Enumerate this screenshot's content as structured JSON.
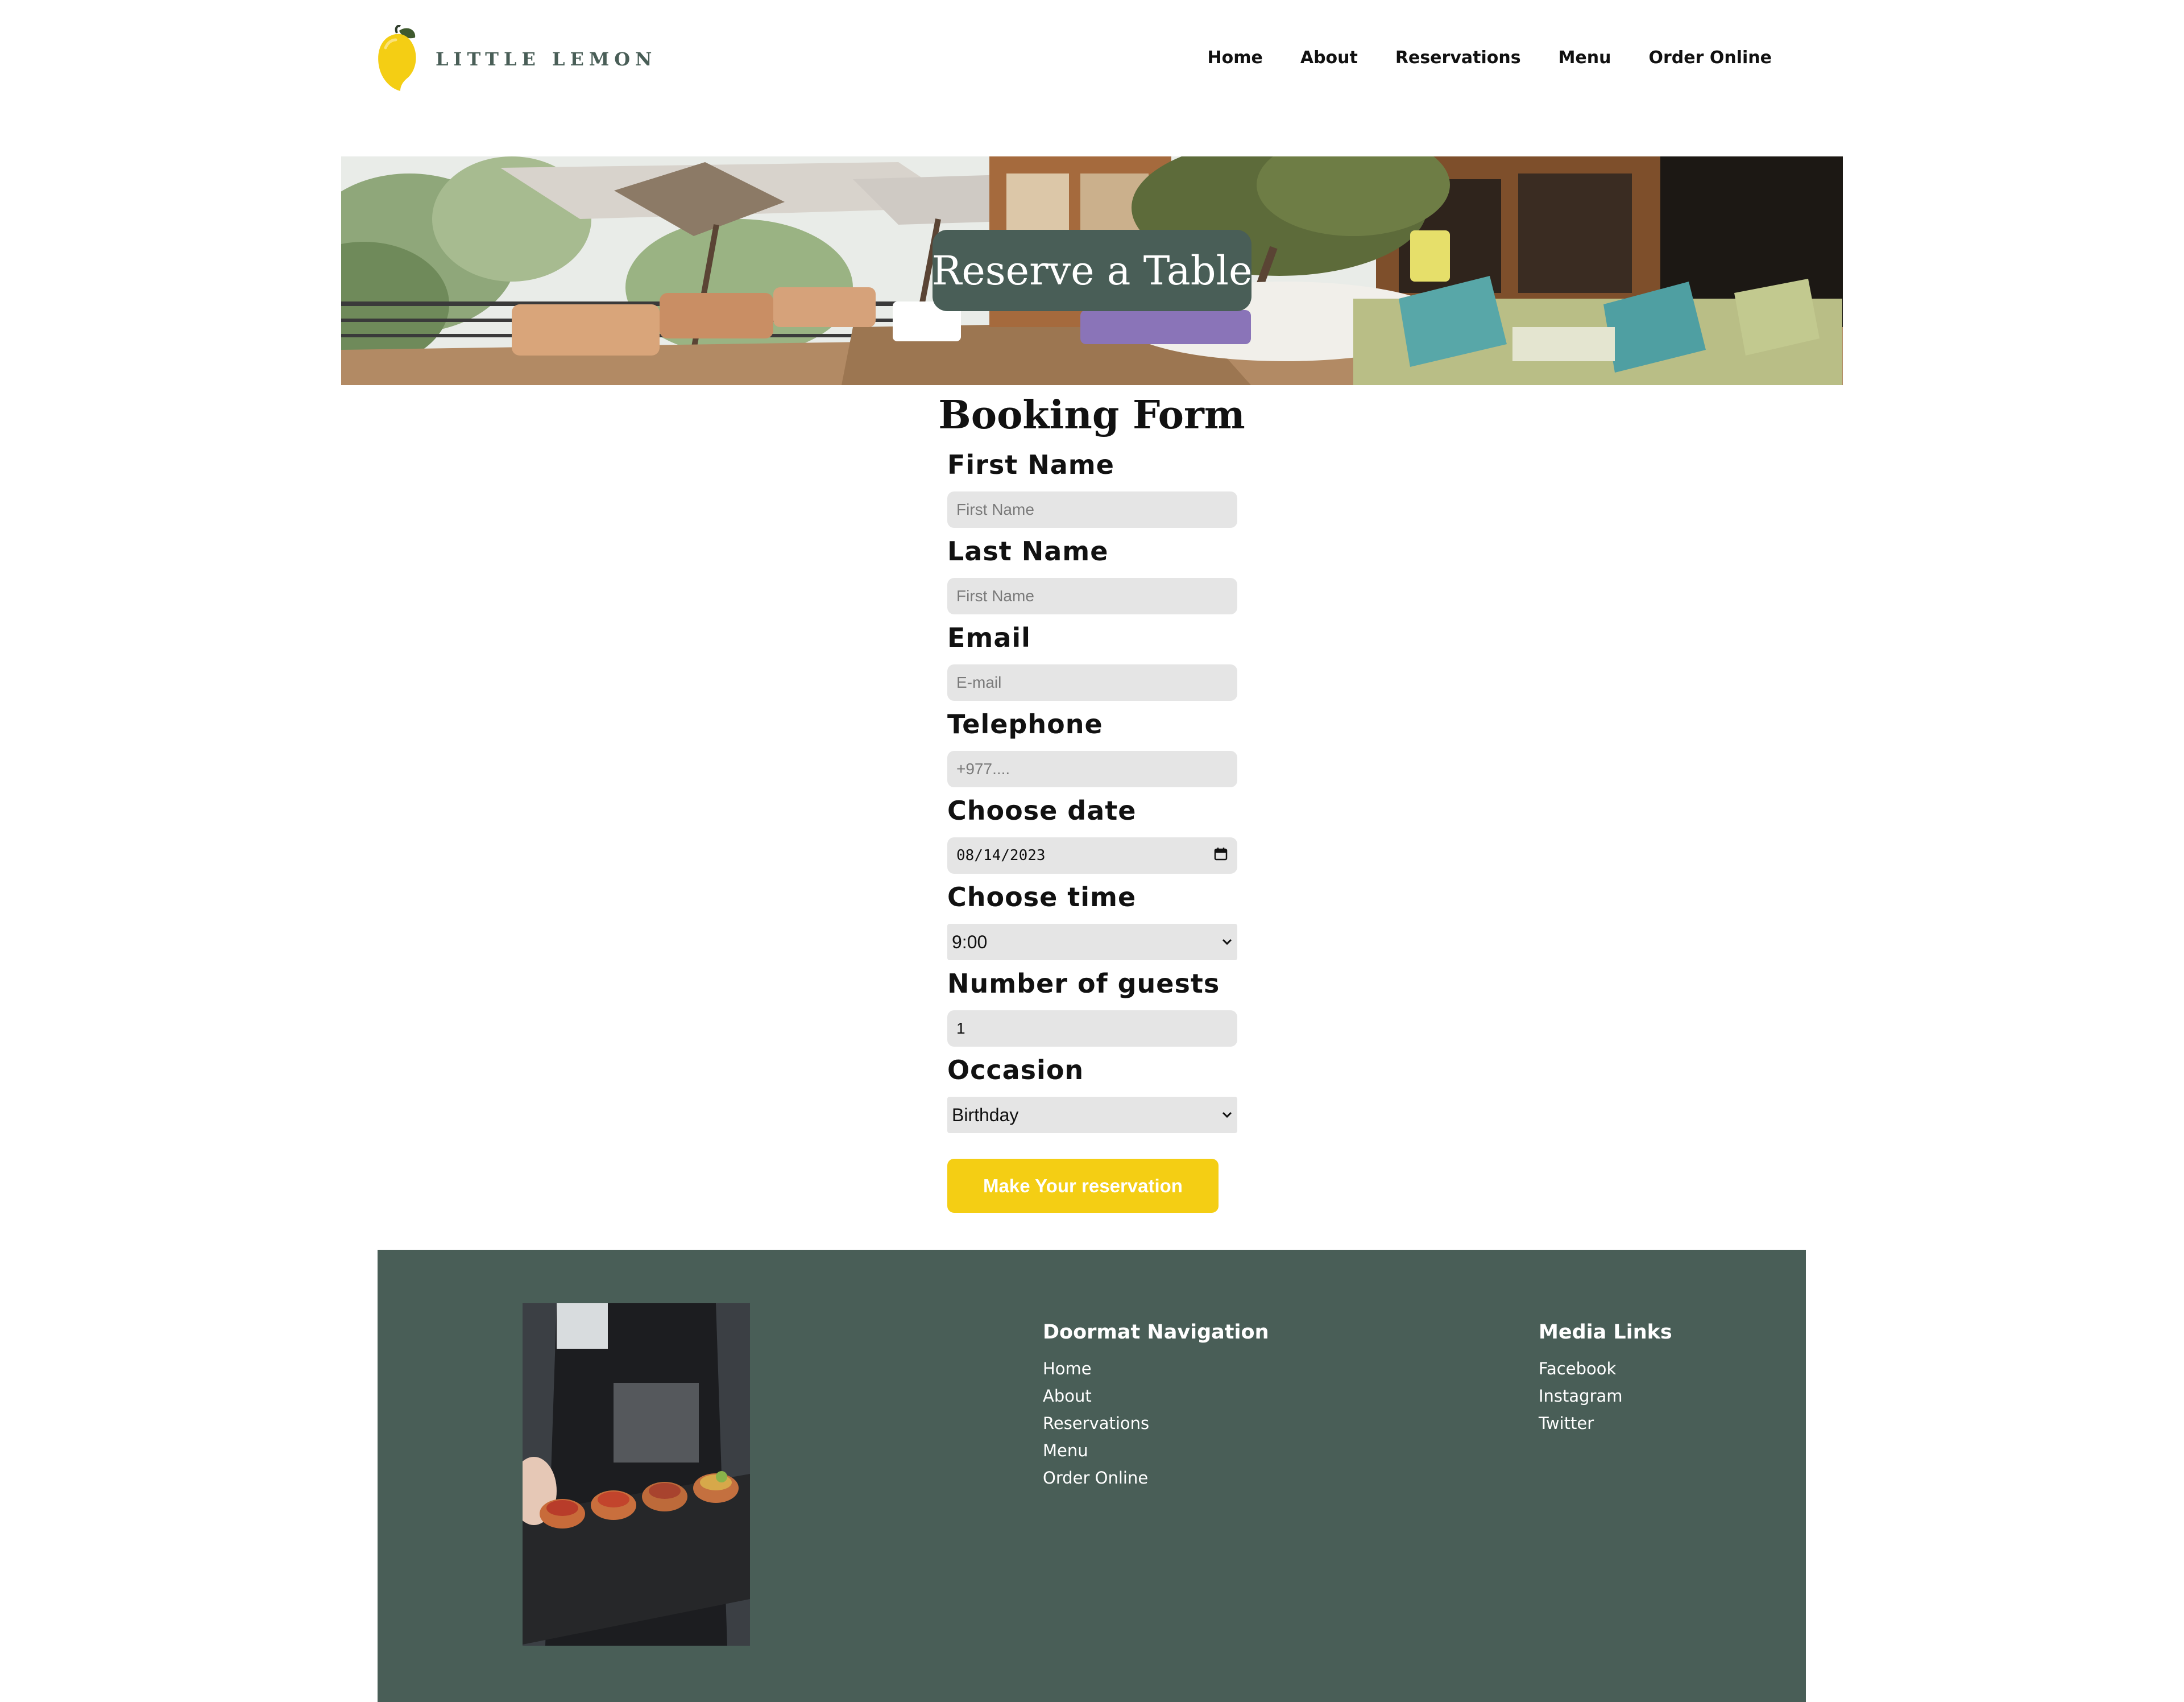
{
  "brand": {
    "name": "LITTLE LEMON",
    "icon": "lemon-logo-icon"
  },
  "nav": {
    "items": [
      {
        "label": "Home"
      },
      {
        "label": "About"
      },
      {
        "label": "Reservations"
      },
      {
        "label": "Menu"
      },
      {
        "label": "Order Online"
      }
    ]
  },
  "hero": {
    "title": "Reserve a Table"
  },
  "form": {
    "title": "Booking Form",
    "first_name": {
      "label": "First Name",
      "placeholder": "First Name"
    },
    "last_name": {
      "label": "Last Name",
      "placeholder": "First Name"
    },
    "email": {
      "label": "Email",
      "placeholder": "E-mail"
    },
    "telephone": {
      "label": "Telephone",
      "placeholder": "+977...."
    },
    "date": {
      "label": "Choose date",
      "value": "08/14/2023",
      "icon": "calendar-icon"
    },
    "time": {
      "label": "Choose time",
      "value": "9:00"
    },
    "guests": {
      "label": "Number of guests",
      "value": "1"
    },
    "occasion": {
      "label": "Occasion",
      "value": "Birthday"
    },
    "submit_label": "Make Your reservation"
  },
  "footer": {
    "nav_heading": "Doormat Navigation",
    "nav_links": [
      {
        "label": "Home"
      },
      {
        "label": "About"
      },
      {
        "label": "Reservations"
      },
      {
        "label": "Menu"
      },
      {
        "label": "Order Online"
      }
    ],
    "media_heading": "Media Links",
    "media_links": [
      {
        "label": "Facebook"
      },
      {
        "label": "Instagram"
      },
      {
        "label": "Twitter"
      }
    ]
  },
  "colors": {
    "primary": "#495e57",
    "accent": "#f4ce14",
    "input_bg": "#e5e5e5"
  }
}
